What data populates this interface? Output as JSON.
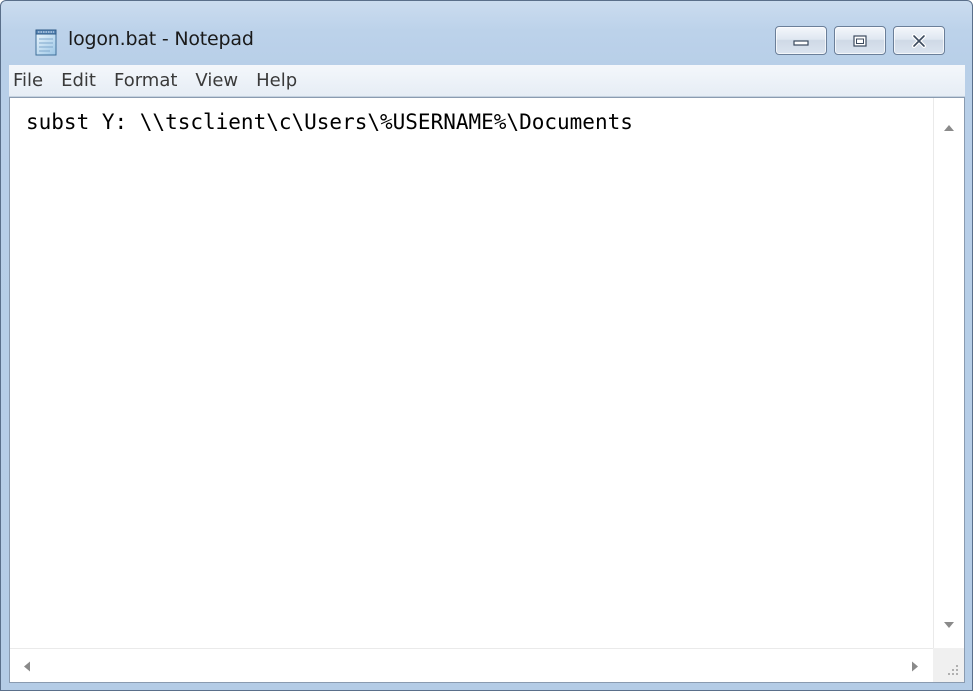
{
  "window": {
    "title": "logon.bat - Notepad",
    "app_icon": "notepad-icon",
    "accent_color": "#bcd2ea"
  },
  "caption_buttons": {
    "minimize_icon": "minimize-icon",
    "maximize_icon": "maximize-icon",
    "close_icon": "close-icon"
  },
  "menu": {
    "items": [
      {
        "label": "File"
      },
      {
        "label": "Edit"
      },
      {
        "label": "Format"
      },
      {
        "label": "View"
      },
      {
        "label": "Help"
      }
    ]
  },
  "editor": {
    "content": "subst Y: \\\\tsclient\\c\\Users\\%USERNAME%\\Documents"
  },
  "scrollbars": {
    "vertical_up_icon": "arrow-up-icon",
    "vertical_down_icon": "arrow-down-icon",
    "horizontal_left_icon": "arrow-left-icon",
    "horizontal_right_icon": "arrow-right-icon",
    "grip_icon": "size-grip-icon"
  }
}
